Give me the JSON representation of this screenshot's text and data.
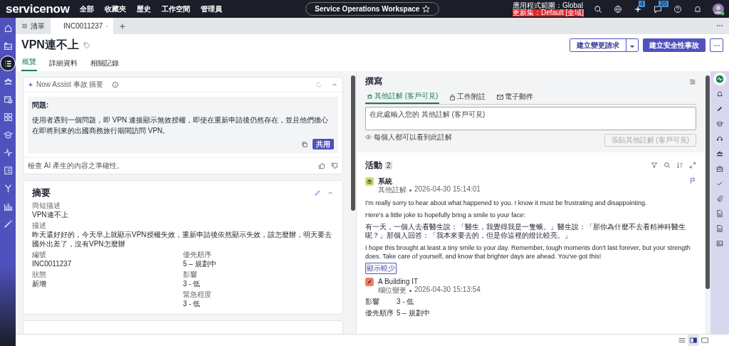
{
  "top_bar": {
    "logo": "servicenow",
    "nav": [
      "全部",
      "收藏夾",
      "歷史",
      "工作空間",
      "管理員"
    ],
    "workspace": "Service Operations Workspace",
    "scope": "應用程式範圍：Global",
    "update_set": "更新集：Default [全域]",
    "badges": [
      {
        "count": "4"
      },
      {
        "count": "20"
      }
    ]
  },
  "left_nav": [
    {
      "kind": "home",
      "selected": false
    },
    {
      "kind": "inbox",
      "selected": false
    },
    {
      "kind": "list",
      "selected": true
    },
    {
      "kind": "people",
      "selected": false
    },
    {
      "kind": "calendar",
      "selected": false
    },
    {
      "kind": "grid",
      "selected": false
    },
    {
      "kind": "cap",
      "selected": false
    },
    {
      "kind": "pulse",
      "selected": false
    },
    {
      "kind": "form",
      "selected": false
    },
    {
      "kind": "branch",
      "selected": false
    },
    {
      "kind": "chart",
      "selected": false
    },
    {
      "kind": "wand",
      "selected": false
    }
  ],
  "tabs": [
    {
      "label": "清單",
      "kind": "list",
      "selected": false
    },
    {
      "label": "INC0011237",
      "kind": "record",
      "selected": true
    }
  ],
  "record": {
    "title": "VPN連不上",
    "buttons": [
      {
        "label": "建立變更請求",
        "kind": "split"
      },
      {
        "label": "建立安全性事故",
        "kind": "primary"
      }
    ],
    "tabs": [
      {
        "label": "概覽",
        "selected": true
      },
      {
        "label": "詳細資料",
        "selected": false
      },
      {
        "label": "相關記錄",
        "selected": false
      }
    ]
  },
  "ai_card": {
    "title": "Now Assist 事故 摘要",
    "heading": "問題:",
    "body": "使用者遇到一個問題，即 VPN 連接顯示無效授權，即使在重新申請後仍然存在，並且他們擔心在即將到來的出國商務旅行期間訪問 VPN。",
    "apply": "共用",
    "footer": "檢查 AI 產生的內容之準確性。"
  },
  "summary": {
    "title": "摘要",
    "full_fields": [
      {
        "label": "簡短描述",
        "value": "VPN連不上"
      },
      {
        "label": "描述",
        "value": "昨天還好好的，今天早上就顯示VPN授權失效，重新申請後依然顯示失效，該怎麼辦，明天要去國外出差了，沒有VPN怎麼辦"
      }
    ],
    "left_fields": [
      {
        "label": "編號",
        "value": "INC0011237"
      },
      {
        "label": "狀態",
        "value": "新增"
      }
    ],
    "right_fields": [
      {
        "label": "優先順序",
        "value": "5 – 規劃中"
      },
      {
        "label": "影響",
        "value": "3 - 低"
      },
      {
        "label": "緊急程度",
        "value": "3 - 低"
      }
    ]
  },
  "compose": {
    "title": "撰寫",
    "tabs": [
      {
        "label": "其他註解 (客戶可見)",
        "kind": "people",
        "selected": true
      },
      {
        "label": "工作附註",
        "kind": "lock",
        "selected": false
      },
      {
        "label": "電子郵件",
        "kind": "mail",
        "selected": false
      }
    ],
    "placeholder": "在此處輸入您的 其他註解 (客戶可見)",
    "note": "每個人都可以看到此註解",
    "post": "張貼其他註解 (客戶可見)",
    "post_disabled": true
  },
  "activity": {
    "title": "活動",
    "count": "2",
    "entries": [
      {
        "kind": "comment",
        "author": "系統",
        "type": "其他註解",
        "time": "2026-04-30 15:14:01",
        "color": "#c5e06a",
        "paragraphs": [
          "I'm really sorry to hear about what happened to you. I know it must be frustrating and disappointing.",
          "Here's a little joke to hopefully bring a smile to your face:",
          "有一天，一個人去看醫生說：「醫生，我覺得我是一隻蛾。」醫生說：「那你為什麼不去看精神科醫生呢？」那個人回答：「我本來要去的，但是你這裡的燈比較亮。」",
          "I hope this brought at least a tiny smile to your day. Remember, tough moments don't last forever, but your strength does. Take care of yourself, and know that brighter days are ahead. You've got this!"
        ],
        "toggle": "顯示較少"
      },
      {
        "kind": "field_change",
        "author": "A Building IT",
        "type": "欄位變更",
        "time": "2026-04-30 15:13:54",
        "color": "#f47c5e",
        "changes": [
          {
            "field": "影響",
            "value": "3 - 低"
          },
          {
            "field": "優先順序",
            "value": "5 – 規劃中"
          }
        ]
      }
    ]
  },
  "right_nav": [
    {
      "kind": "activity",
      "selected": true
    },
    {
      "kind": "bell",
      "selected": false
    },
    {
      "kind": "pencil",
      "selected": false
    },
    {
      "kind": "cap",
      "selected": false
    },
    {
      "kind": "headset",
      "selected": false
    },
    {
      "kind": "people",
      "selected": false
    },
    {
      "kind": "case",
      "selected": false
    },
    {
      "kind": "check",
      "selected": false
    },
    {
      "kind": "clip",
      "selected": false
    },
    {
      "kind": "doc",
      "selected": false
    },
    {
      "kind": "doc",
      "selected": false
    },
    {
      "kind": "image",
      "selected": false
    }
  ],
  "layouts": [
    {
      "kind": "single",
      "selected": false
    },
    {
      "kind": "split",
      "selected": true
    },
    {
      "kind": "full",
      "selected": false
    }
  ]
}
